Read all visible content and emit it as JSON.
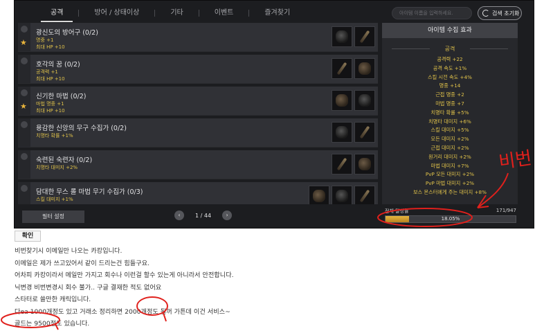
{
  "tabs": [
    {
      "label": "공격",
      "active": true
    },
    {
      "label": "방어 / 상태이상",
      "active": false
    },
    {
      "label": "기타",
      "active": false
    },
    {
      "label": "이벤트",
      "active": false
    },
    {
      "label": "즐겨찾기",
      "active": false
    }
  ],
  "search": {
    "placeholder": "아이템 이름을 입력하세요."
  },
  "reset_label": "검색 초기화",
  "collections": [
    {
      "title": "광신도의 방어구 (0/2)",
      "stat1": "명중 +1",
      "stat2": "최대 HP +10",
      "starred": true,
      "slots": 2
    },
    {
      "title": "호각의 꿈 (0/2)",
      "stat1": "공격력 +1",
      "stat2": "최대 HP +10",
      "starred": false,
      "slots": 2
    },
    {
      "title": "신기한 마법 (0/2)",
      "stat1": "마법 명중 +1",
      "stat2": "최대 HP +10",
      "starred": true,
      "slots": 2
    },
    {
      "title": "용감한 신앙의 무구 수집가 (0/2)",
      "stat1": "치명타 확률 +1%",
      "stat2": "",
      "starred": false,
      "slots": 2
    },
    {
      "title": "숙련된 숙련자 (0/2)",
      "stat1": "치명타 대미지 +2%",
      "stat2": "",
      "starred": false,
      "slots": 2
    },
    {
      "title": "담대한 무스 롤 마법 무기 수집가 (0/3)",
      "stat1": "스킬 대미지 +1%",
      "stat2": "",
      "starred": false,
      "slots": 3
    }
  ],
  "panel": {
    "header": "아이템 수집 효과",
    "category": "공격",
    "effects": [
      "공격력 +22",
      "공격 속도 +1%",
      "스킬 시전 속도 +4%",
      "명중 +14",
      "근접 명중 +2",
      "마법 명중 +7",
      "치명타 확률 +5%",
      "치명타 대미지 +6%",
      "스킬 대미지 +5%",
      "모든 대미지 +2%",
      "근접 대미지 +2%",
      "원거리 대미지 +2%",
      "마법 대미지 +7%",
      "PvP 모든 대미지 +2%",
      "PvP 마법 대미지 +2%",
      "보스 몬스터에게 주는 대미지 +8%"
    ]
  },
  "filter_label": "필터 설정",
  "pager": {
    "prev": "‹",
    "label": "1 / 44",
    "next": "›"
  },
  "progress": {
    "label": "전체 달성률",
    "count": "171/947",
    "pct_text": "18.05%",
    "pct": 18.05
  },
  "confirm_label": "확인",
  "annotation": "비번",
  "body_lines": [
    "비번찾기시 이메일만 나오는 카캉입니다.",
    "이메일은 제가 쓰고있어서 같이 드리는건 힘들구요.",
    "어차피 카캉이라서 메일만 가지고 회수나 이런걸 할수 있는게 아니라서 안전합니다.",
    "닉변경 비번변경시 회수 불가.. 구글 결재한 적도 없어요",
    "스타터로 쓸만한 캐릭입니다.",
    "다ea 1000개정도 있고 거래소 정리하면 2000개정도 될꺼 가튼데 이건 서비스~",
    "골드는 9500정도 있습니다."
  ],
  "colors": {
    "accent": "#e0c24a",
    "annotation": "#e0201c"
  }
}
